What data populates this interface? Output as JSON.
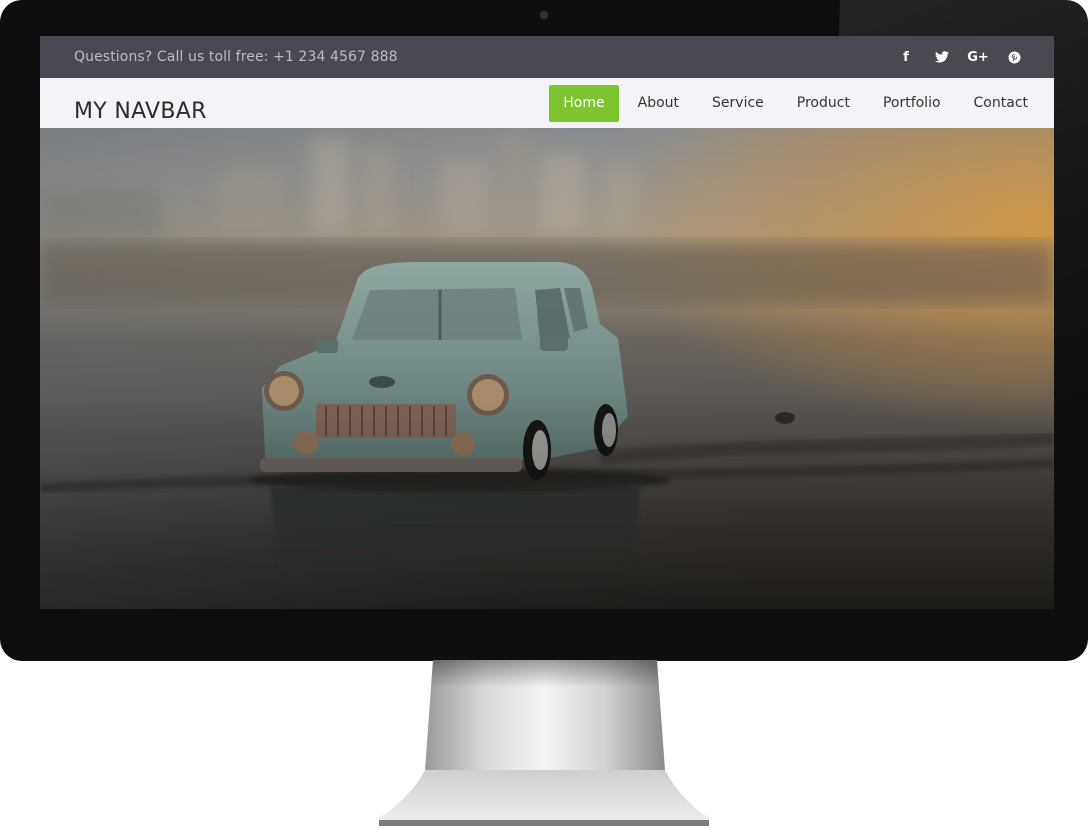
{
  "topbar": {
    "contact_text": "Questions? Call us toll free: +1 234 4567 888",
    "social": [
      {
        "icon": "facebook-icon",
        "glyph": "f"
      },
      {
        "icon": "twitter-icon"
      },
      {
        "icon": "google-plus-icon",
        "glyph": "G+"
      },
      {
        "icon": "pinterest-icon"
      }
    ]
  },
  "navbar": {
    "brand": "MY NAVBAR",
    "active_color": "#7cc52e",
    "items": [
      {
        "label": "Home",
        "active": true
      },
      {
        "label": "About",
        "active": false
      },
      {
        "label": "Service",
        "active": false
      },
      {
        "label": "Product",
        "active": false
      },
      {
        "label": "Portfolio",
        "active": false
      },
      {
        "label": "Contact",
        "active": false
      }
    ]
  },
  "hero": {
    "image": "vintage toy car on wet beach at sunset"
  }
}
